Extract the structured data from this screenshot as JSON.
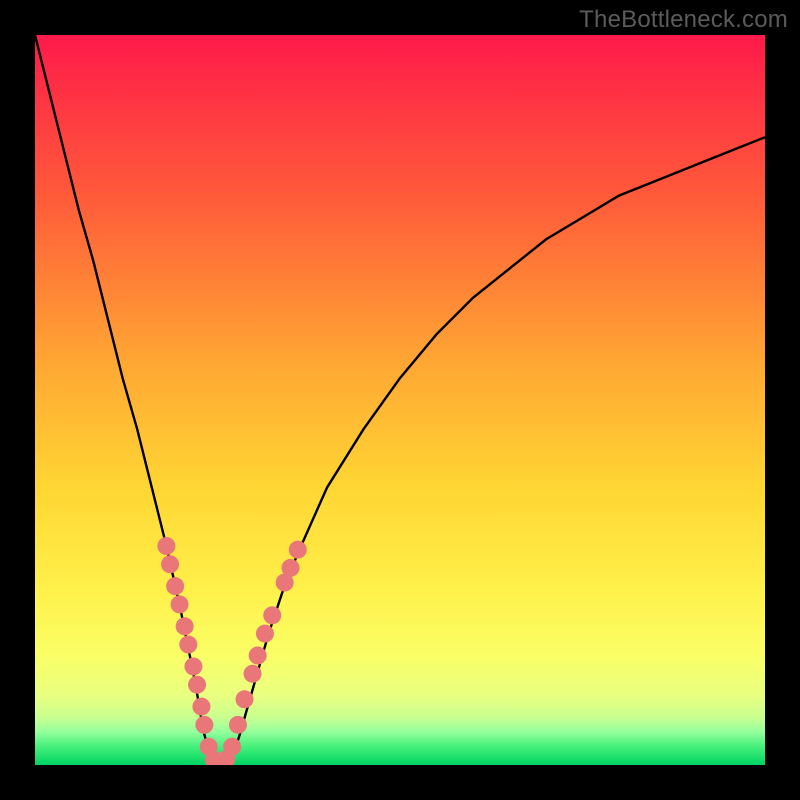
{
  "watermark": "TheBottleneck.com",
  "colors": {
    "frame": "#000000",
    "curve": "#000000",
    "dot_fill": "#e9777a",
    "gradient_stops": [
      {
        "offset": 0.0,
        "color": "#ff1a4a"
      },
      {
        "offset": 0.22,
        "color": "#ff5a3a"
      },
      {
        "offset": 0.45,
        "color": "#ffa733"
      },
      {
        "offset": 0.62,
        "color": "#ffd633"
      },
      {
        "offset": 0.76,
        "color": "#fff04a"
      },
      {
        "offset": 0.85,
        "color": "#faff66"
      },
      {
        "offset": 0.905,
        "color": "#e9ff80"
      },
      {
        "offset": 0.935,
        "color": "#c8ff90"
      },
      {
        "offset": 0.955,
        "color": "#93ff9c"
      },
      {
        "offset": 0.975,
        "color": "#45f07a"
      },
      {
        "offset": 1.0,
        "color": "#00d463"
      }
    ]
  },
  "chart_data": {
    "type": "line",
    "title": "",
    "xlabel": "",
    "ylabel": "",
    "xlim": [
      0,
      100
    ],
    "ylim": [
      0,
      100
    ],
    "series": [
      {
        "name": "bottleneck-curve",
        "x": [
          0,
          2,
          4,
          6,
          8,
          10,
          12,
          14,
          16,
          18,
          20,
          22,
          23,
          24,
          25,
          26,
          27,
          28,
          30,
          32,
          34,
          36,
          40,
          45,
          50,
          55,
          60,
          65,
          70,
          75,
          80,
          85,
          90,
          95,
          100
        ],
        "y": [
          100,
          92,
          84,
          76,
          69,
          61,
          53,
          46,
          38,
          30,
          21,
          11,
          5,
          1,
          0,
          0,
          1,
          4,
          11,
          18,
          24,
          29,
          38,
          46,
          53,
          59,
          64,
          68,
          72,
          75,
          78,
          80,
          82,
          84,
          86
        ]
      }
    ],
    "highlight_dots": {
      "name": "marked-points",
      "points": [
        {
          "x": 18.0,
          "y": 30.0
        },
        {
          "x": 18.5,
          "y": 27.5
        },
        {
          "x": 19.2,
          "y": 24.5
        },
        {
          "x": 19.8,
          "y": 22.0
        },
        {
          "x": 20.5,
          "y": 19.0
        },
        {
          "x": 21.0,
          "y": 16.5
        },
        {
          "x": 21.7,
          "y": 13.5
        },
        {
          "x": 22.2,
          "y": 11.0
        },
        {
          "x": 22.8,
          "y": 8.0
        },
        {
          "x": 23.2,
          "y": 5.5
        },
        {
          "x": 23.8,
          "y": 2.5
        },
        {
          "x": 24.5,
          "y": 0.7
        },
        {
          "x": 25.0,
          "y": 0.3
        },
        {
          "x": 25.6,
          "y": 0.3
        },
        {
          "x": 26.2,
          "y": 0.8
        },
        {
          "x": 27.0,
          "y": 2.5
        },
        {
          "x": 27.8,
          "y": 5.5
        },
        {
          "x": 28.7,
          "y": 9.0
        },
        {
          "x": 29.8,
          "y": 12.5
        },
        {
          "x": 30.5,
          "y": 15.0
        },
        {
          "x": 31.5,
          "y": 18.0
        },
        {
          "x": 32.5,
          "y": 20.5
        },
        {
          "x": 34.2,
          "y": 25.0
        },
        {
          "x": 35.0,
          "y": 27.0
        },
        {
          "x": 36.0,
          "y": 29.5
        }
      ]
    }
  }
}
